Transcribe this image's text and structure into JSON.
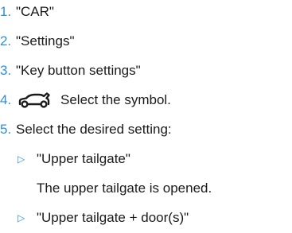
{
  "steps": [
    {
      "num": "1.",
      "text": "\"CAR\""
    },
    {
      "num": "2.",
      "text": "\"Settings\""
    },
    {
      "num": "3.",
      "text": "\"Key button settings\""
    },
    {
      "num": "4.",
      "text": "Select the symbol.",
      "icon": "car-tailgate-open-icon"
    },
    {
      "num": "5.",
      "text": "Select the desired setting:"
    }
  ],
  "options": [
    {
      "bullet": "▷",
      "label": "\"Upper tailgate\"",
      "description": "The upper tailgate is opened."
    },
    {
      "bullet": "▷",
      "label": "\"Upper tailgate + door(s)\""
    }
  ],
  "colors": {
    "accent": "#2f8fd6",
    "text": "#1a1a1a"
  }
}
